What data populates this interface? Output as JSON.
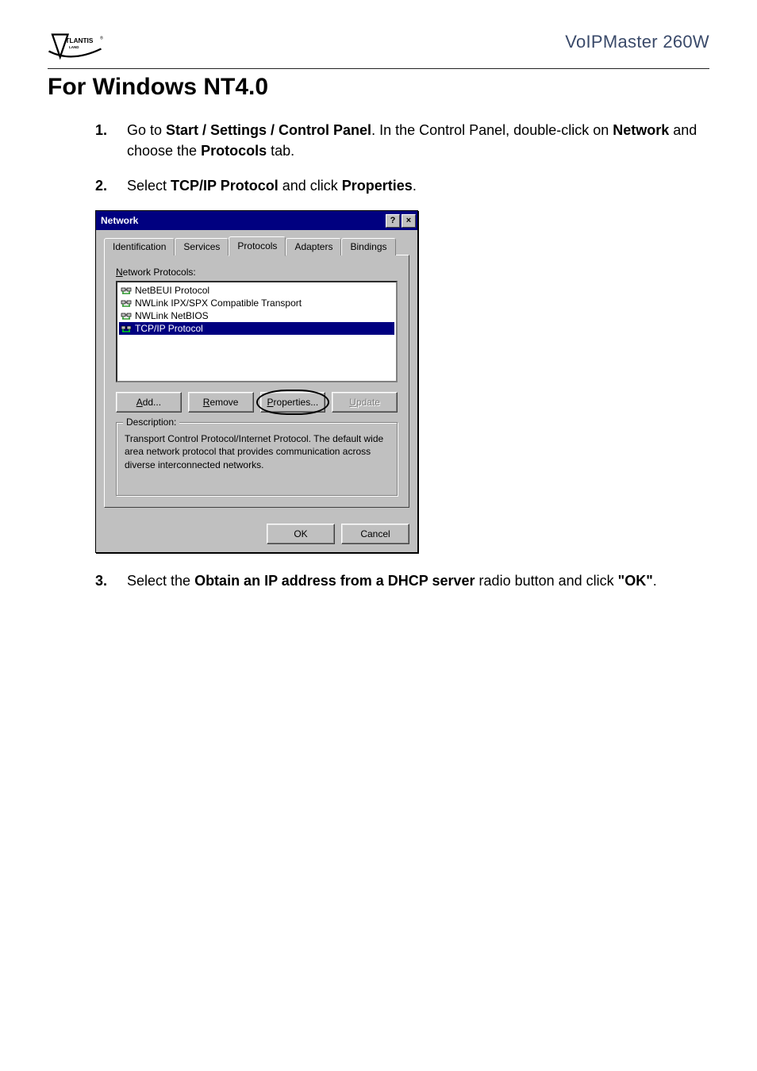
{
  "header": {
    "logo_text_top": "TLANTIS",
    "logo_reg": "®",
    "logo_text_bottom": "LAND",
    "product": "VoIPMaster 260W"
  },
  "title": "For Windows NT4.0",
  "steps": {
    "s1_pre": "Go to ",
    "s1_b1": "Start / Settings / Control Panel",
    "s1_mid": ". In the Control Panel, double-click on ",
    "s1_b2": "Network",
    "s1_mid2": " and choose the ",
    "s1_b3": "Protocols",
    "s1_end": " tab.",
    "s2_pre": "Select ",
    "s2_b1": "TCP/IP Protocol",
    "s2_mid": " and click ",
    "s2_b2": "Properties",
    "s2_end": ".",
    "s3_pre": "Select the ",
    "s3_b1": "Obtain an IP address from a DHCP server",
    "s3_mid": " radio button and click ",
    "s3_b2": "\"OK\"",
    "s3_end": "."
  },
  "dialog": {
    "title": "Network",
    "help_glyph": "?",
    "close_glyph": "×",
    "tabs": [
      "Identification",
      "Services",
      "Protocols",
      "Adapters",
      "Bindings"
    ],
    "active_tab_index": 2,
    "list_label": "Network Protocols:",
    "protocols": [
      {
        "label": "NetBEUI Protocol",
        "selected": false
      },
      {
        "label": "NWLink IPX/SPX Compatible Transport",
        "selected": false
      },
      {
        "label": "NWLink NetBIOS",
        "selected": false
      },
      {
        "label": "TCP/IP Protocol",
        "selected": true
      }
    ],
    "buttons": {
      "add_u": "A",
      "add_rest": "dd...",
      "remove_u": "R",
      "remove_rest": "emove",
      "props_u": "P",
      "props_rest": "roperties...",
      "update_u": "U",
      "update_rest": "pdate"
    },
    "desc_title": "Description:",
    "desc_text": "Transport Control Protocol/Internet Protocol. The default wide area network protocol that provides communication across diverse interconnected networks.",
    "ok": "OK",
    "cancel": "Cancel"
  }
}
